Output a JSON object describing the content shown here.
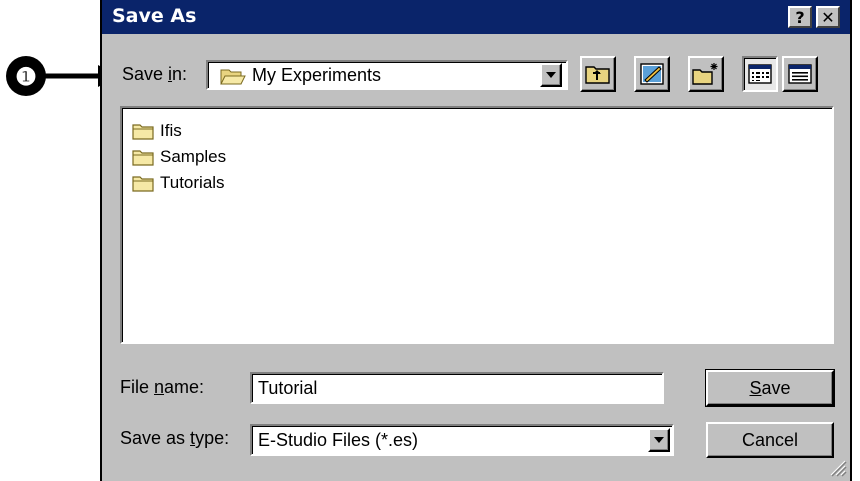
{
  "callout": {
    "number": "❶"
  },
  "dialog": {
    "title": "Save As",
    "help_button": "?",
    "close_button": "✕",
    "save_in": {
      "label_prefix": "Save ",
      "label_underlined": "i",
      "label_suffix": "n:",
      "value": "My Experiments"
    },
    "toolbar": {
      "icons": [
        "up-one-level-icon",
        "desktop-icon",
        "new-folder-icon",
        "list-view-icon",
        "details-view-icon"
      ]
    },
    "file_list": {
      "items": [
        {
          "label": "Ifis",
          "icon": "folder-icon"
        },
        {
          "label": "Samples",
          "icon": "folder-icon"
        },
        {
          "label": "Tutorials",
          "icon": "folder-icon"
        }
      ]
    },
    "file_name": {
      "label_prefix": "File ",
      "label_underlined": "n",
      "label_suffix": "ame:",
      "value": "Tutorial"
    },
    "save_as_type": {
      "label_prefix": "Save as ",
      "label_underlined": "t",
      "label_suffix": "ype:",
      "value": "E-Studio Files (*.es)"
    },
    "buttons": {
      "save_underlined": "S",
      "save_rest": "ave",
      "cancel": "Cancel"
    }
  }
}
